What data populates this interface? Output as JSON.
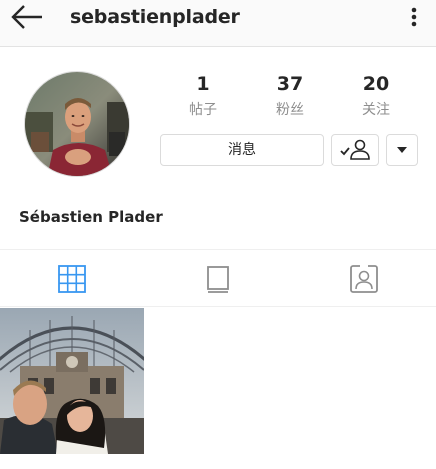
{
  "header": {
    "username": "sebastienplader",
    "back_icon": "arrow-left-icon",
    "more_icon": "more-vertical-icon"
  },
  "profile": {
    "full_name": "Sébastien Plader",
    "avatar_icon": "profile-photo"
  },
  "stats": [
    {
      "value": "1",
      "label": "帖子"
    },
    {
      "value": "37",
      "label": "粉丝"
    },
    {
      "value": "20",
      "label": "关注"
    }
  ],
  "actions": {
    "message_label": "消息",
    "following_icon": "user-check-icon",
    "dropdown_icon": "triangle-down-icon"
  },
  "tabs": [
    {
      "name": "grid",
      "icon": "grid-icon",
      "active": true
    },
    {
      "name": "feed",
      "icon": "list-view-icon",
      "active": false
    },
    {
      "name": "tagged",
      "icon": "tagged-person-icon",
      "active": false
    }
  ],
  "colors": {
    "active_tab": "#3897f0",
    "inactive_tab": "#8e8e8e",
    "text": "#262626",
    "secondary_text": "#8e8e8e",
    "border": "#dbdbdb"
  }
}
